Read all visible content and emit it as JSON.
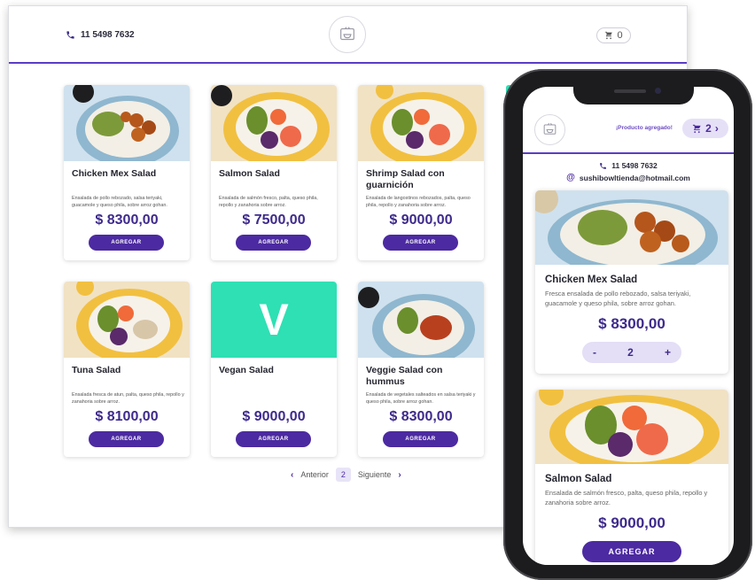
{
  "desktop": {
    "header": {
      "phone": "11 5498 7632",
      "cart_count": "0",
      "icons": {
        "phone": "phone-icon",
        "cart": "cart-icon",
        "logo": "bowl-logo-icon"
      }
    },
    "products": [
      {
        "name": "Chicken Mex Salad",
        "description": "Ensalada de pollo rebozado, salsa teriyaki, guacamole y queso phila, sobre arroz gohan.",
        "price": "$ 8300,00",
        "button": "AGREGAR",
        "image": "chicken-bowl"
      },
      {
        "name": "Salmon Salad",
        "description": "Ensalada de salmón fresco, palta, queso phila, repollo y zanahoria sobre arroz.",
        "price": "$ 7500,00",
        "button": "AGREGAR",
        "image": "salmon-bowl"
      },
      {
        "name": "Shrimp Salad con guarnición",
        "description": "Ensalada de langostinos rebozados, palta, queso phila, repollo y zanahoria sobre arroz.",
        "price": "$ 9000,00",
        "button": "AGREGAR",
        "image": "shrimp-bowl"
      },
      {
        "name": "Tuna Salad",
        "description": "Ensalada fresca de atun, palta, queso phila, repollo y zanahoria sobre arroz.",
        "price": "$ 8100,00",
        "button": "AGREGAR",
        "image": "tuna-bowl"
      },
      {
        "name": "Vegan Salad",
        "description": "",
        "price": "$ 9000,00",
        "button": "AGREGAR",
        "image": "vegan-placeholder",
        "placeholder_letter": "V"
      },
      {
        "name": "Veggie Salad con hummus",
        "description": "Ensalada de vegetales salteados en salsa teriyaki y queso phila, sobre arroz gohan.",
        "price": "$ 8300,00",
        "button": "AGREGAR",
        "image": "veggie-bowl"
      }
    ],
    "pagination": {
      "prev": "Anterior",
      "current": "2",
      "next": "Siguiente"
    }
  },
  "mobile": {
    "header": {
      "added_message": "¡Producto agregado!",
      "cart_count": "2"
    },
    "contact": {
      "phone": "11 5498 7632",
      "email": "sushibowltienda@hotmail.com"
    },
    "products": [
      {
        "name": "Chicken Mex Salad",
        "description": "Fresca ensalada de pollo rebozado, salsa teriyaki, guacamole y queso phila, sobre arroz gohan.",
        "price": "$ 8300,00",
        "stepper": {
          "minus": "-",
          "qty": "2",
          "plus": "+"
        }
      },
      {
        "name": "Salmon Salad",
        "description": "Ensalada de salmón fresco, palta, queso phila, repollo y zanahoria sobre arroz.",
        "price": "$ 9000,00",
        "button": "AGREGAR"
      }
    ]
  },
  "colors": {
    "primary": "#4c2aa1",
    "price": "#3e2a8c",
    "accent_line": "#5b3cc4",
    "vegan_tile": "#2ee0b4",
    "pill_bg": "#e6e0f7"
  }
}
